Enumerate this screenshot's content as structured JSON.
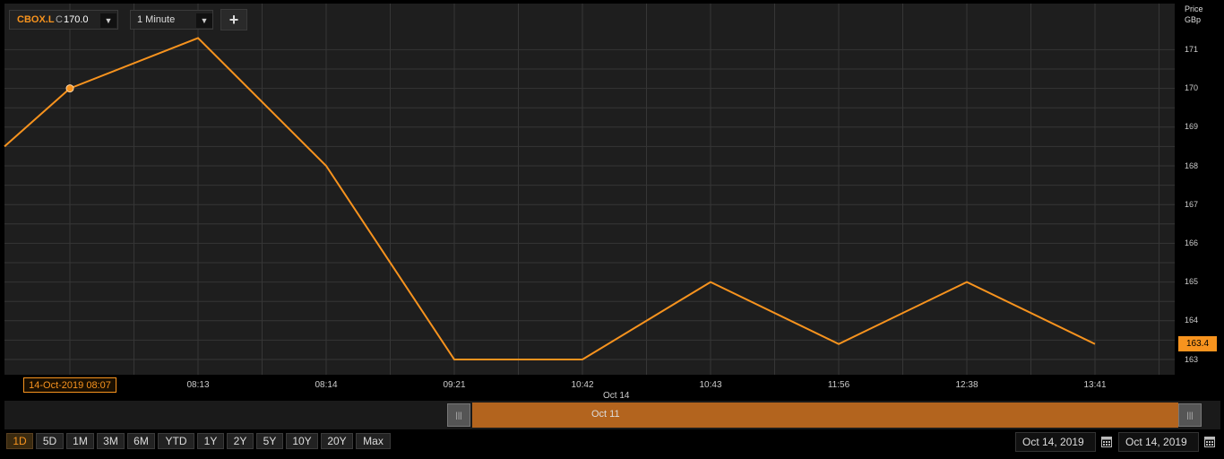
{
  "toolbar": {
    "symbol": "CBOX.L",
    "close_prefix": "C",
    "close_value": "170.0",
    "interval": "1 Minute",
    "add_label": "+"
  },
  "y_axis": {
    "header_line1": "Price",
    "header_line2": "GBp",
    "ticks": [
      "171",
      "170",
      "169",
      "168",
      "167",
      "166",
      "165",
      "164",
      "163"
    ]
  },
  "last_price_tag": "163.4",
  "crosshair_date": "14-Oct-2019 08:07",
  "date_separator": "Oct 14",
  "navigator": {
    "label": "Oct 11",
    "handle_glyph": "|||"
  },
  "range_buttons": [
    "1D",
    "5D",
    "1M",
    "3M",
    "6M",
    "YTD",
    "1Y",
    "2Y",
    "5Y",
    "10Y",
    "20Y",
    "Max"
  ],
  "active_range": "1D",
  "date_from": "Oct 14, 2019",
  "date_to": "Oct 14, 2019",
  "colors": {
    "accent": "#f7931e",
    "plot_bg": "#1e1e1e",
    "grid": "#363636",
    "nav_window": "#b3641e"
  },
  "chart_data": {
    "type": "line",
    "series": [
      {
        "values": [
          168.5,
          170.0,
          171.3,
          168.0,
          163.0,
          163.0,
          165.0,
          163.4,
          165.0,
          163.4
        ]
      }
    ],
    "x": [
      "",
      "",
      "08:13",
      "08:14",
      "09:21",
      "10:42",
      "10:43",
      "11:56",
      "12:38",
      "13:41"
    ],
    "ylim": [
      162.6,
      171.7
    ],
    "highlighted_index": 1,
    "grid": true
  }
}
